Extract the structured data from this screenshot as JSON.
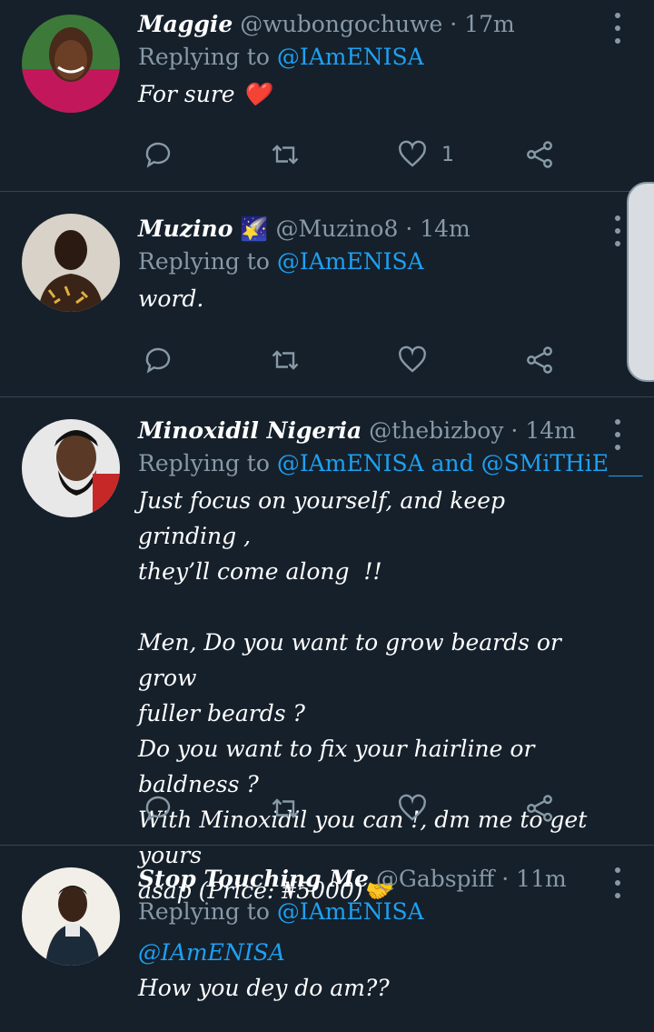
{
  "colors": {
    "background": "#15202b",
    "secondary_text": "#8899a6",
    "accent": "#1da1f2",
    "divider": "#38444d"
  },
  "tweets": [
    {
      "name": "Maggie",
      "name_emoji": "",
      "handle": "@wubongochuwe",
      "time": "17m",
      "replying_label": "Replying to",
      "replying_to": "@IAmENISA",
      "replying_join": "",
      "replying_to_2": "",
      "body_mention": "",
      "body": "For sure ❤️",
      "like_count": "1",
      "avatar_icon": "avatar-maggie"
    },
    {
      "name": "Muzino",
      "name_emoji": "🌠",
      "handle": "@Muzino8",
      "time": "14m",
      "replying_label": "Replying to",
      "replying_to": "@IAmENISA",
      "replying_join": "",
      "replying_to_2": "",
      "body_mention": "",
      "body": "word.",
      "like_count": "",
      "avatar_icon": "avatar-muzino"
    },
    {
      "name": "Minoxidil Nigeria",
      "name_emoji": "",
      "handle": "@thebizboy",
      "time": "14m",
      "replying_label": "Replying to",
      "replying_to": "@IAmENISA",
      "replying_join": "and",
      "replying_to_2": "@SMiTHiE___",
      "body_mention": "",
      "body": "Just focus on yourself, and keep grinding ,\nthey’ll come along  !!\n\nMen, Do you want to grow beards or grow\nfuller beards ?\nDo you want to fix your hairline or baldness ?\nWith Minoxidil you can !, dm me to get yours\nasap (Price: ₦5000)🤝",
      "like_count": "",
      "avatar_icon": "avatar-minoxidil"
    },
    {
      "name": "Stop Touching Me",
      "name_emoji": "",
      "handle": "@Gabspiff",
      "time": "11m",
      "replying_label": "Replying to",
      "replying_to": "@IAmENISA",
      "replying_join": "",
      "replying_to_2": "",
      "body_mention": "@IAmENISA",
      "body": "How you dey do am??",
      "like_count": "",
      "avatar_icon": "avatar-stop-touching-me"
    }
  ],
  "separator_dot": "·"
}
